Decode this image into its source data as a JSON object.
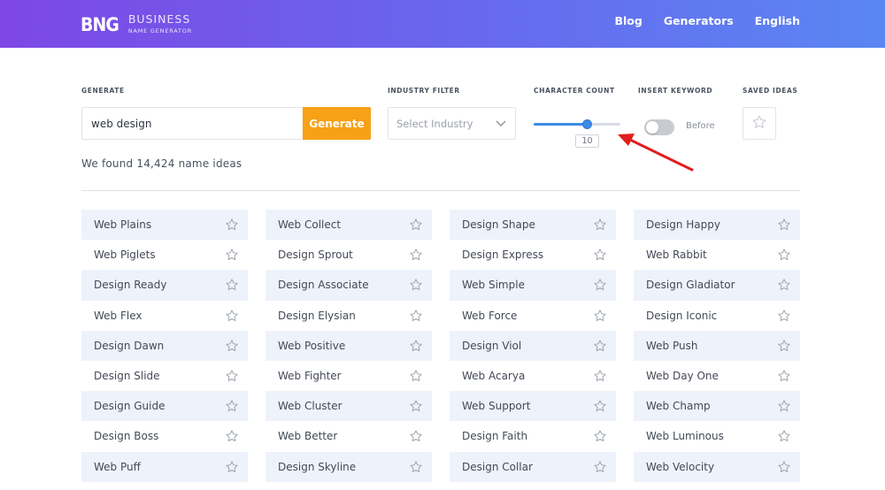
{
  "header": {
    "logo_mark": "BNG",
    "logo_title": "BUSINESS",
    "logo_subtitle": "NAME GENERATOR",
    "nav": [
      "Blog",
      "Generators",
      "English"
    ]
  },
  "filters": {
    "generate_label": "GENERATE",
    "generate_value": "web design",
    "generate_button": "Generate",
    "industry_label": "INDUSTRY FILTER",
    "industry_placeholder": "Select Industry",
    "character_label": "CHARACTER COUNT",
    "character_value": "10",
    "character_fraction": 0.62,
    "keyword_label": "INSERT KEYWORD",
    "keyword_toggle_text": "Before",
    "keyword_toggle_on": false,
    "saved_label": "SAVED IDEAS"
  },
  "results": {
    "found_text": "We found 14,424 name ideas",
    "columns": [
      [
        "Web Plains",
        "Web Piglets",
        "Design Ready",
        "Web Flex",
        "Design Dawn",
        "Design Slide",
        "Design Guide",
        "Design Boss",
        "Web Puff"
      ],
      [
        "Web Collect",
        "Design Sprout",
        "Design Associate",
        "Design Elysian",
        "Web Positive",
        "Web Fighter",
        "Web Cluster",
        "Web Better",
        "Design Skyline"
      ],
      [
        "Design Shape",
        "Design Express",
        "Web Simple",
        "Web Force",
        "Design Viol",
        "Web Acarya",
        "Web Support",
        "Design Faith",
        "Design Collar"
      ],
      [
        "Design Happy",
        "Web Rabbit",
        "Design Gladiator",
        "Design Iconic",
        "Web Push",
        "Web Day One",
        "Web Champ",
        "Web Luminous",
        "Web Velocity"
      ]
    ]
  },
  "colors": {
    "header_start": "#7e47e6",
    "header_end": "#5a86f3",
    "accent_orange": "#f7a116",
    "slider_blue": "#3a8be6",
    "row_shade": "#eef2fb",
    "arrow_red": "#e01e1e"
  },
  "icons": {
    "star": "star-outline-icon",
    "chevron": "chevron-down-icon",
    "annotation": "red-arrow-icon"
  }
}
